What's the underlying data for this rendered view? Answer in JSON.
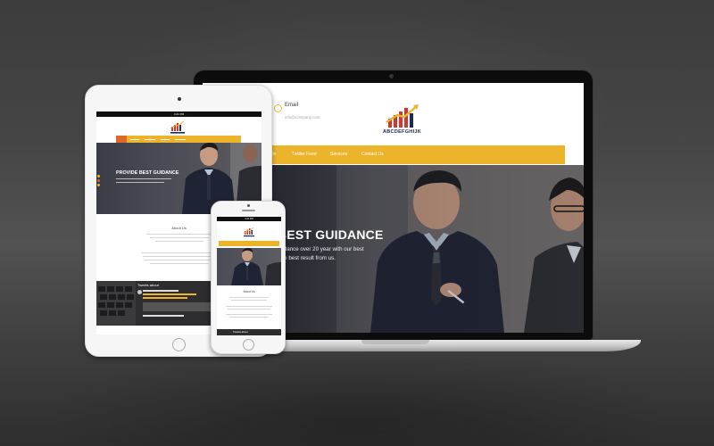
{
  "laptop": {
    "contact": {
      "label": "Email",
      "value": "info@company.com"
    },
    "logo_text": "ABCDEFGHIJK",
    "nav": [
      "Us",
      "Twitter Feed",
      "Services",
      "Contact Us"
    ],
    "hero": {
      "title": "BEST GUIDANCE",
      "subtitle_line1": "uidance over 20 year with our best",
      "subtitle_line2": "the best result from us."
    }
  },
  "tablet": {
    "status_time": "4:21 PM",
    "hero_title": "PROVIDE BEST GUIDANCE",
    "about_title": "About Us",
    "tweets_title": "Tweets about"
  },
  "phone": {
    "status_time": "4:21 PM",
    "about_title": "About Us",
    "tweets_title": "Tweets about"
  },
  "colors": {
    "accent": "#ebb42b",
    "accent_dark": "#e0672a",
    "logo_navy": "#1c2a5a",
    "logo_red": "#d9342b"
  }
}
